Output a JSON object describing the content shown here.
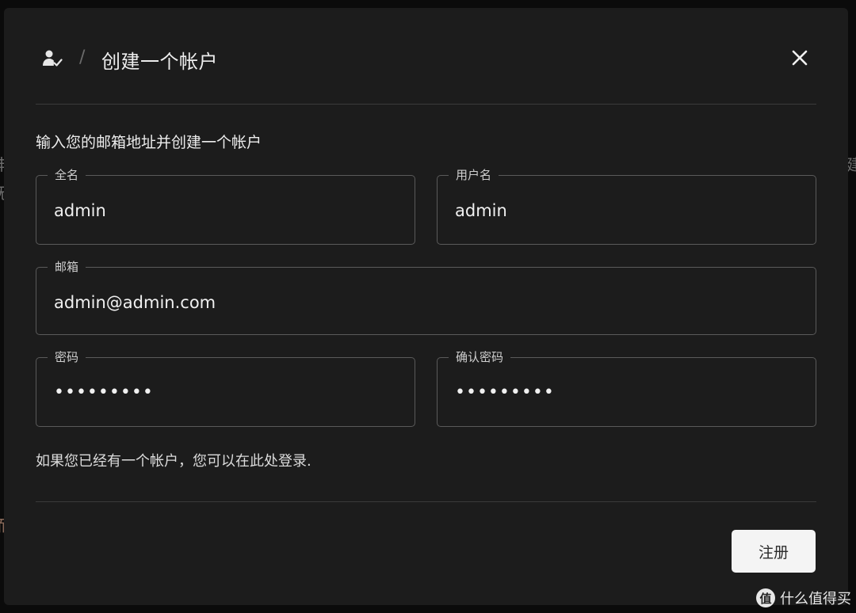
{
  "dialog": {
    "title": "创建一个帐户",
    "separator": "/",
    "subtitle": "输入您的邮箱地址并创建一个帐户",
    "close_icon": "close-icon",
    "header_icon": "user-check-icon"
  },
  "form": {
    "full_name": {
      "label": "全名",
      "value": "admin"
    },
    "username": {
      "label": "用户名",
      "value": "admin"
    },
    "email": {
      "label": "邮箱",
      "value": "admin@admin.com"
    },
    "password": {
      "label": "密码",
      "value": "•••••••••"
    },
    "confirm_password": {
      "label": "确认密码",
      "value": "•••••••••"
    }
  },
  "login_hint": "如果您已经有一个帐户，您可以在此处登录.",
  "register_button": "注册",
  "watermark": {
    "logo": "值",
    "text": "什么值得买"
  },
  "background_fragments": [
    "丰",
    "无",
    "而",
    "建"
  ]
}
